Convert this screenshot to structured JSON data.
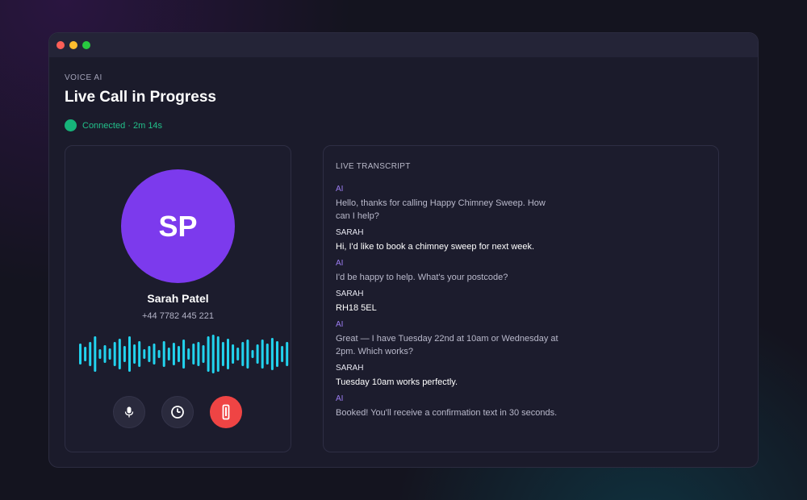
{
  "header": {
    "eyebrow": "VOICE AI",
    "title": "Live Call in Progress",
    "status": "Connected · 2m 14s"
  },
  "caller": {
    "initials": "SP",
    "name": "Sarah Patel",
    "phone": "+44 7782 445 221"
  },
  "controls": {
    "mic_icon": "microphone-icon",
    "timer_icon": "clock-icon",
    "end_icon": "end-call-icon"
  },
  "transcript": {
    "heading": "LIVE TRANSCRIPT",
    "messages": [
      {
        "speaker": "AI",
        "text": "Hello, thanks for calling Happy Chimney Sweep. How can I help?"
      },
      {
        "speaker": "SARAH",
        "text": "Hi, I'd like to book a chimney sweep for next week."
      },
      {
        "speaker": "AI",
        "text": "I'd be happy to help. What's your postcode?"
      },
      {
        "speaker": "SARAH",
        "text": "RH18 5EL"
      },
      {
        "speaker": "AI",
        "text": "Great — I have Tuesday 22nd at 10am or Wednesday at 2pm. Which works?"
      },
      {
        "speaker": "SARAH",
        "text": "Tuesday 10am works perfectly."
      },
      {
        "speaker": "AI",
        "text": "Booked! You'll receive a confirmation text in 30 seconds."
      }
    ]
  },
  "colors": {
    "accent": "#7c3aed",
    "connected": "#16b47a",
    "waveform": "#22d3ee",
    "end_call": "#ef4444"
  }
}
